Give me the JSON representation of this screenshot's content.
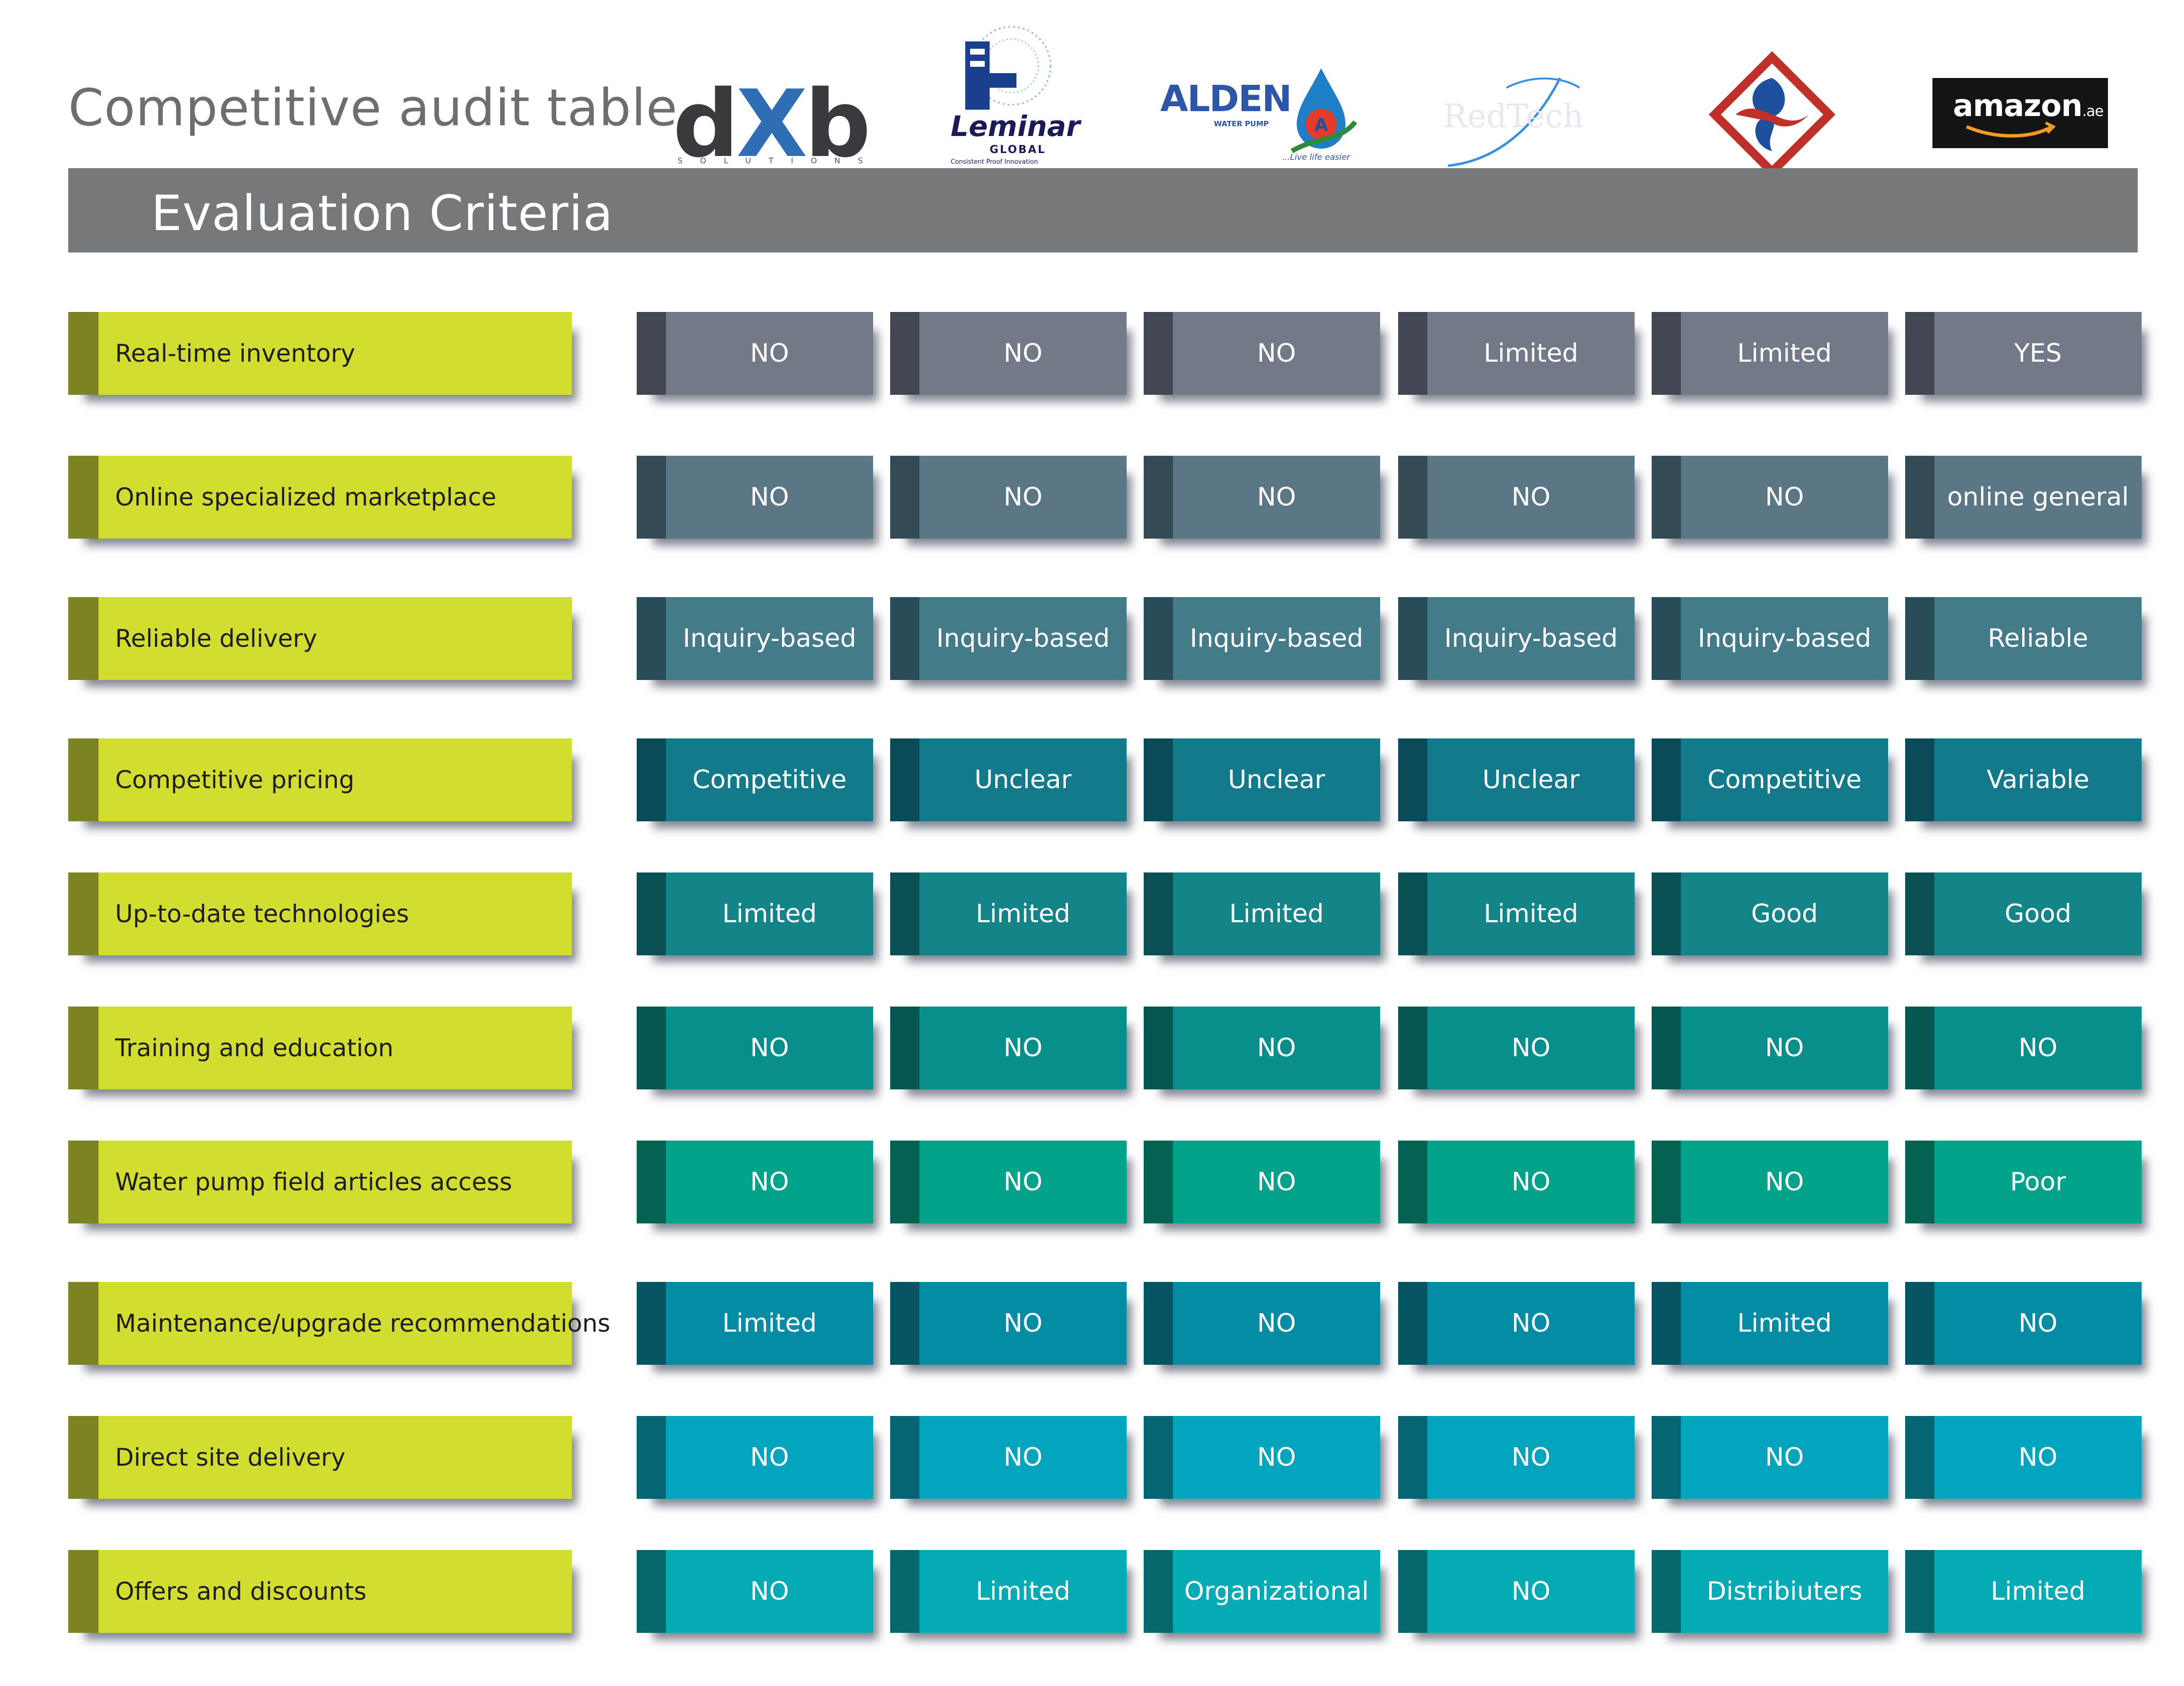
{
  "page_title": "Competitive audit table",
  "header": {
    "label": "Evaluation Criteria"
  },
  "logos": {
    "dxb": {
      "wordmark": "dXb",
      "sub": "SOLUTIONS"
    },
    "leminar": {
      "name": "Leminar",
      "global": "GLOBAL",
      "tag": "Consistent Proof Innovation"
    },
    "alden": {
      "name": "ALDEN",
      "sub": "WATER PUMP",
      "tag": "...Live life easier"
    },
    "redtech": {
      "name": "RedTech"
    },
    "amazon": {
      "name": "amazon",
      "suffix": ".ae"
    }
  },
  "rows": [
    {
      "criterion": "Real-time inventory",
      "values": [
        "NO",
        "NO",
        "NO",
        "Limited",
        "Limited",
        "YES"
      ],
      "color": "#737a87",
      "dark": "#424753"
    },
    {
      "criterion": "Online specialized marketplace",
      "values": [
        "NO",
        "NO",
        "NO",
        "NO",
        "NO",
        "online general"
      ],
      "color": "#5b7785",
      "dark": "#344a55"
    },
    {
      "criterion": "Reliable delivery",
      "values": [
        "Inquiry-based",
        "Inquiry-based",
        "Inquiry-based",
        "Inquiry-based",
        "Inquiry-based",
        "Reliable"
      ],
      "color": "#437b89",
      "dark": "#284d58"
    },
    {
      "criterion": "Competitive pricing",
      "values": [
        "Competitive",
        "Unclear",
        "Unclear",
        "Unclear",
        "Competitive",
        "Variable"
      ],
      "color": "#137a8b",
      "dark": "#0b4b57"
    },
    {
      "criterion": "Up-to-date technologies",
      "values": [
        "Limited",
        "Limited",
        "Limited",
        "Limited",
        "Good",
        "Good"
      ],
      "color": "#138488",
      "dark": "#0b5052"
    },
    {
      "criterion": "Training and education",
      "values": [
        "NO",
        "NO",
        "NO",
        "NO",
        "NO",
        "NO"
      ],
      "color": "#098f8b",
      "dark": "#065651"
    },
    {
      "criterion": "Water pump field articles access",
      "values": [
        "NO",
        "NO",
        "NO",
        "NO",
        "NO",
        "Poor"
      ],
      "color": "#02a38a",
      "dark": "#046253"
    },
    {
      "criterion": "Maintenance/upgrade recommendations",
      "values": [
        "Limited",
        "NO",
        "NO",
        "NO",
        "Limited",
        "NO"
      ],
      "color": "#038ca3",
      "dark": "#055563"
    },
    {
      "criterion": "Direct site delivery",
      "values": [
        "NO",
        "NO",
        "NO",
        "NO",
        "NO",
        "NO"
      ],
      "color": "#02a5bd",
      "dark": "#066572"
    },
    {
      "criterion": "Offers and discounts",
      "values": [
        "NO",
        "Limited",
        "Organizational",
        "NO",
        "Distribiuters",
        "Limited"
      ],
      "color": "#04abb5",
      "dark": "#06676d"
    }
  ]
}
